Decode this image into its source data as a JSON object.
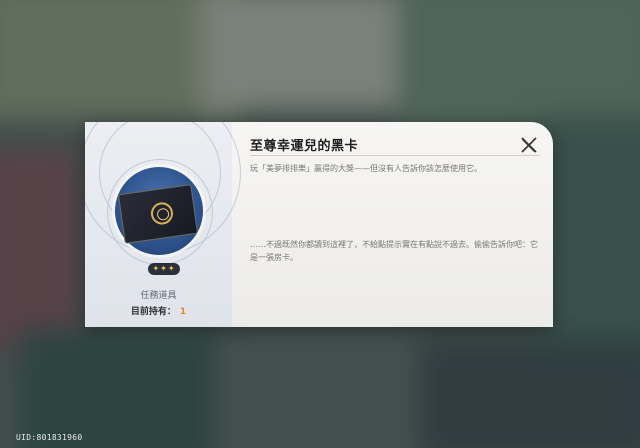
{
  "item": {
    "title": "至尊幸運兒的黑卡",
    "description": "玩「美夢排排樂」贏得的大獎——但沒有人告訴你該怎麼使用它。",
    "flavor_text": "……不過既然你都讀到這裡了，不給點提示實在有點說不過去。偷偷告訴你吧：它是一張房卡。",
    "rarity_stars": "✦✦✦",
    "type": "任務道具",
    "owned_label": "目前持有：",
    "owned_count": "1"
  },
  "uid": "UID:801831960",
  "icons": {
    "close": "close-icon",
    "item": "black-card-icon"
  },
  "colors": {
    "accent_count": "#e6892e",
    "stars": "#f3c23c",
    "item_bg": "#2f558f"
  }
}
